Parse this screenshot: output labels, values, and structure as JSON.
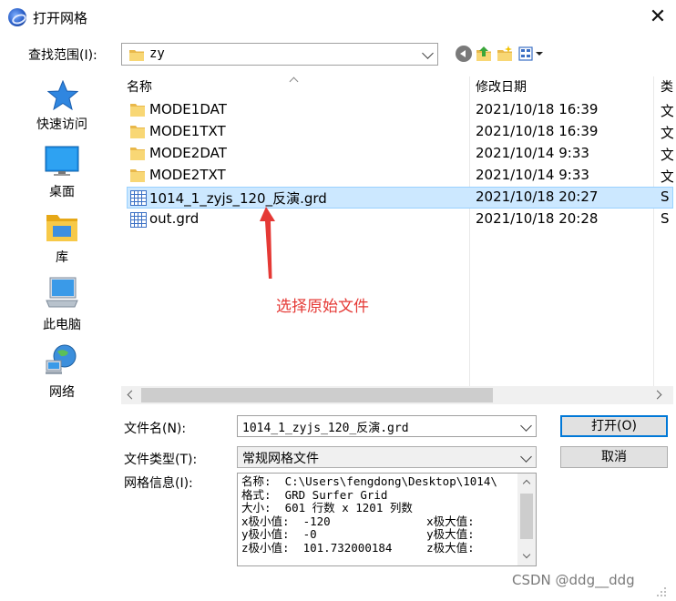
{
  "window": {
    "title": "打开网格"
  },
  "lookin": {
    "label": "查找范围(I):",
    "value": "zy"
  },
  "places": [
    {
      "key": "quick",
      "label": "快速访问",
      "icon": "star-icon"
    },
    {
      "key": "desktop",
      "label": "桌面",
      "icon": "desktop-icon"
    },
    {
      "key": "library",
      "label": "库",
      "icon": "library-folder-icon"
    },
    {
      "key": "pc",
      "label": "此电脑",
      "icon": "computer-icon"
    },
    {
      "key": "network",
      "label": "网络",
      "icon": "network-icon"
    }
  ],
  "columns": {
    "name": "名称",
    "date": "修改日期",
    "type": "类"
  },
  "files": [
    {
      "name": "MODE1DAT",
      "date": "2021/10/18 16:39",
      "type": "文",
      "icon": "folder-icon",
      "selected": false
    },
    {
      "name": "MODE1TXT",
      "date": "2021/10/18 16:39",
      "type": "文",
      "icon": "folder-icon",
      "selected": false
    },
    {
      "name": "MODE2DAT",
      "date": "2021/10/14 9:33",
      "type": "文",
      "icon": "folder-icon",
      "selected": false
    },
    {
      "name": "MODE2TXT",
      "date": "2021/10/14 9:33",
      "type": "文",
      "icon": "folder-icon",
      "selected": false
    },
    {
      "name": "1014_1_zyjs_120_反演.grd",
      "date": "2021/10/18 20:27",
      "type": "S",
      "icon": "grid-file-icon",
      "selected": true
    },
    {
      "name": "out.grd",
      "date": "2021/10/18 20:28",
      "type": "S",
      "icon": "grid-file-icon",
      "selected": false
    }
  ],
  "annotation": {
    "text": "选择原始文件",
    "color": "#e53935"
  },
  "filename": {
    "label": "文件名(N):",
    "value": "1014_1_zyjs_120_反演.grd"
  },
  "filetype": {
    "label": "文件类型(T):",
    "value": "常规网格文件"
  },
  "gridinfo": {
    "label": "网格信息(I):",
    "lines": [
      "名称:  C:\\Users\\fengdong\\Desktop\\1014\\",
      "格式:  GRD Surfer Grid",
      "大小:  601 行数 x 1201 列数",
      "x极小值:  -120              x极大值:",
      "y极小值:  -0                y极大值:",
      "z极小值:  101.732000184     z极大值:"
    ]
  },
  "buttons": {
    "open": "打开(O)",
    "cancel": "取消"
  },
  "watermark": "CSDN @ddg__ddg",
  "colors": {
    "selection": "#cce8ff",
    "primary_border": "#0078d7"
  }
}
